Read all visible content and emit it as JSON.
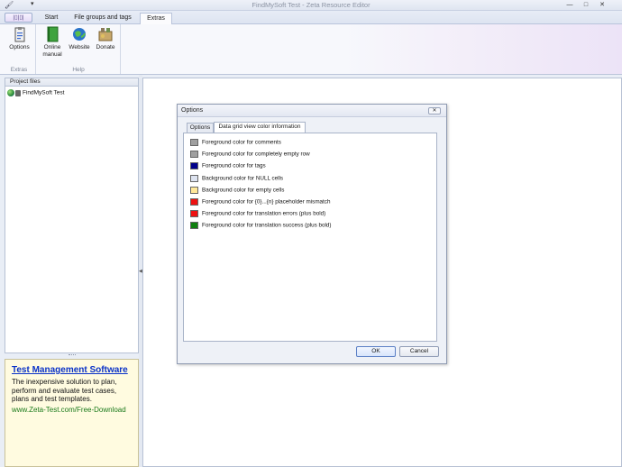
{
  "window": {
    "title": "FindMySoft Test - Zeta Resource Editor",
    "minimize": "—",
    "maximize": "□",
    "close": "✕"
  },
  "ribbon": {
    "app_button": "",
    "tabs": [
      "Start",
      "File groups and tags",
      "Extras"
    ],
    "groups": [
      {
        "label": "Extras",
        "buttons": [
          {
            "label": "Options",
            "icon": "options-clipboard-icon"
          }
        ]
      },
      {
        "label": "Help",
        "buttons": [
          {
            "label": "Online manual",
            "icon": "book-icon"
          },
          {
            "label": "Website",
            "icon": "globe-icon"
          },
          {
            "label": "Donate",
            "icon": "donate-icon"
          }
        ]
      }
    ]
  },
  "left_panel": {
    "header": "Project files",
    "tree": [
      {
        "label": "FindMySoft Test"
      }
    ]
  },
  "ad": {
    "title": "Test Management Software",
    "text": "The inexpensive solution to plan, perform and evaluate test cases, plans and test templates.",
    "link": "www.Zeta-Test.com/Free-Download"
  },
  "dialog": {
    "title": "Options",
    "close": "✕",
    "tabs": [
      "Options",
      "Data grid view color information"
    ],
    "active_tab": "Data grid view color information",
    "colors": [
      {
        "color": "#a0a0a0",
        "label": "Foreground color for comments"
      },
      {
        "color": "#a0a0a0",
        "label": "Foreground color for completely empty row"
      },
      {
        "color": "#00008b",
        "label": "Foreground color for tags"
      },
      {
        "color": "#dde3f0",
        "label": "Background color for NULL cells"
      },
      {
        "color": "#ffe89a",
        "label": "Background color for empty cells"
      },
      {
        "color": "#ee1111",
        "label": "Foreground color for {0}...{n} placeholder mismatch"
      },
      {
        "color": "#ee1111",
        "label": "Foreground color for translation errors (plus bold)"
      },
      {
        "color": "#108010",
        "label": "Foreground color for translation success (plus bold)"
      }
    ],
    "ok": "OK",
    "cancel": "Cancel"
  }
}
